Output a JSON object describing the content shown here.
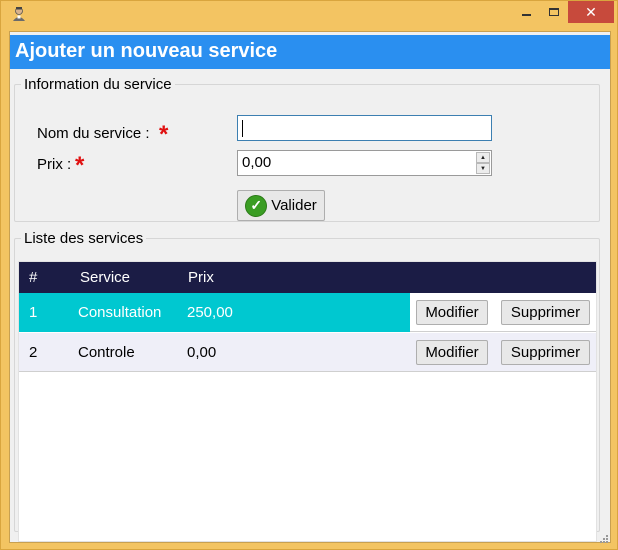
{
  "window": {
    "controls": {
      "minimize": "minimize",
      "maximize": "maximize",
      "close": "close"
    }
  },
  "header": {
    "title": "Ajouter un nouveau service"
  },
  "form": {
    "legend": "Information du service",
    "name_label": "Nom du service :",
    "price_label": "Prix :",
    "required_mark": "*",
    "name_value": "",
    "price_value": "0,00",
    "submit_label": "Valider"
  },
  "list": {
    "legend": "Liste des services",
    "columns": [
      "#",
      "Service",
      "Prix"
    ],
    "rows": [
      {
        "id": "1",
        "service": "Consultation",
        "price": "250,00",
        "selected": true,
        "modify": "Modifier",
        "delete": "Supprimer"
      },
      {
        "id": "2",
        "service": "Controle",
        "price": "0,00",
        "selected": false,
        "modify": "Modifier",
        "delete": "Supprimer"
      }
    ]
  },
  "colors": {
    "header_bg": "#2a8ff0",
    "grid_header_bg": "#1b1c45",
    "selected_row_bg": "#00c8d0",
    "row_alt_bg": "#efeff8",
    "window_frame": "#f3c462",
    "close_button": "#c74a3c",
    "required_star": "#e01010"
  },
  "icons": [
    "user-app-icon",
    "check-icon",
    "spin-up-icon",
    "spin-down-icon",
    "resize-grip-icon"
  ]
}
